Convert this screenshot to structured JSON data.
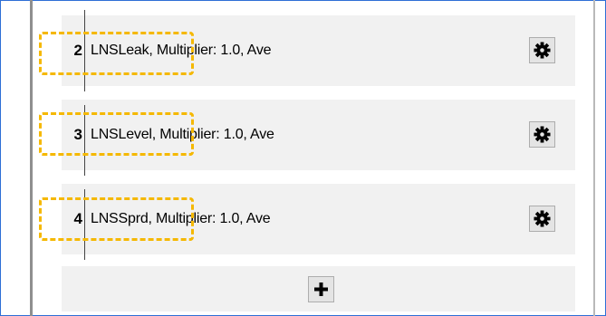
{
  "rows": [
    {
      "number": "2",
      "description": "LNSLeak, Multiplier: 1.0, Ave",
      "icon": "gear-icon"
    },
    {
      "number": "3",
      "description": "LNSLevel, Multiplier: 1.0, Ave",
      "icon": "gear-icon"
    },
    {
      "number": "4",
      "description": "LNSSprd, Multiplier: 1.0, Ave",
      "icon": "gear-icon"
    }
  ],
  "add_button": {
    "icon": "plus-icon"
  },
  "colors": {
    "highlight": "#f5b800",
    "row_background": "#f1f1f1",
    "frame_border": "#2e6fd6"
  }
}
